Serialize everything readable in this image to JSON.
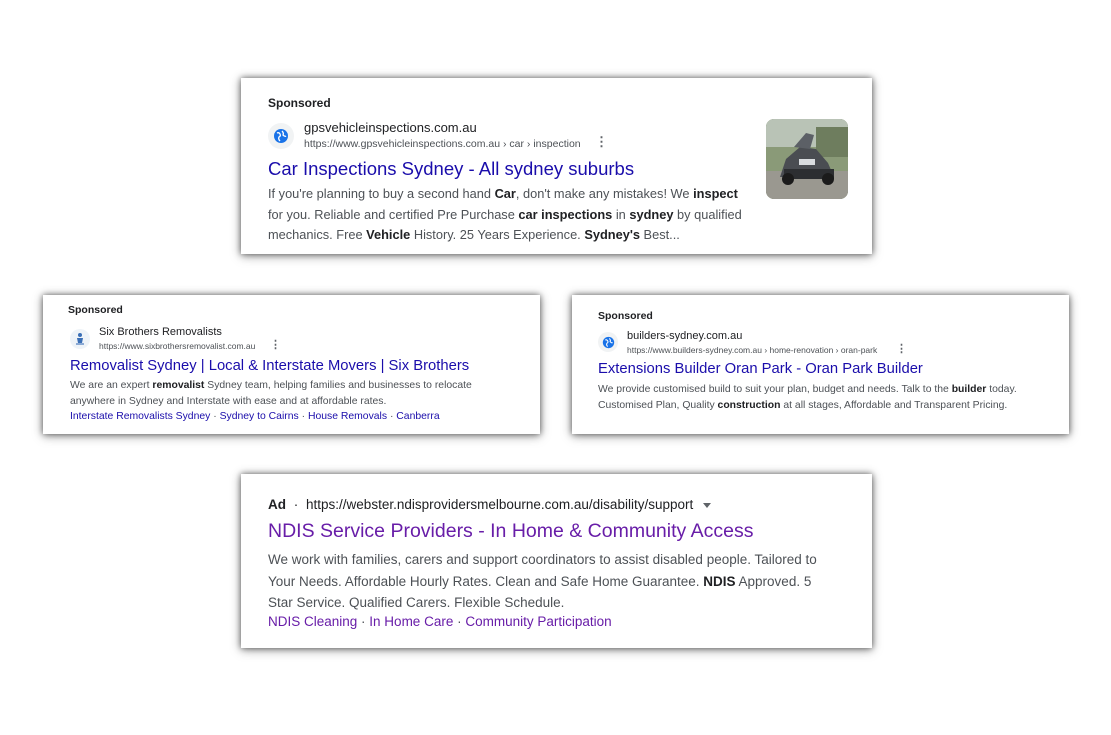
{
  "ad1": {
    "sponsored": "Sponsored",
    "domain": "gpsvehicleinspections.com.au",
    "url": "https://www.gpsvehicleinspections.com.au › car › inspection",
    "title": "Car Inspections Sydney - All sydney suburbs",
    "desc": [
      {
        "t": "If you're planning to buy a second hand "
      },
      {
        "b": "Car"
      },
      {
        "t": ", don't make any mistakes! We "
      },
      {
        "b": "inspect"
      },
      {
        "t": " for you. Reliable and certified Pre Purchase "
      },
      {
        "b": "car inspections"
      },
      {
        "t": " in "
      },
      {
        "b": "sydney"
      },
      {
        "t": " by qualified mechanics. Free "
      },
      {
        "b": "Vehicle"
      },
      {
        "t": " History. 25 Years Experience. "
      },
      {
        "b": "Sydney's"
      },
      {
        "t": " Best..."
      }
    ],
    "icon": "globe-icon",
    "thumbnail": "car-photo"
  },
  "ad2": {
    "sponsored": "Sponsored",
    "domain": "Six Brothers Removalists",
    "url": "https://www.sixbrothersremovalist.com.au",
    "title": "Removalist Sydney | Local & Interstate Movers | Six Brothers",
    "desc": [
      {
        "t": "We are an expert "
      },
      {
        "b": "removalist"
      },
      {
        "t": " Sydney team, helping families and businesses to relocate anywhere in Sydney and Interstate with ease and at affordable rates."
      }
    ],
    "sitelinks": [
      "Interstate Removalists Sydney",
      "Sydney to Cairns",
      "House Removals",
      "Canberra"
    ],
    "icon": "mover-logo-icon"
  },
  "ad3": {
    "sponsored": "Sponsored",
    "domain": "builders-sydney.com.au",
    "url": "https://www.builders-sydney.com.au › home-renovation › oran-park",
    "title": "Extensions Builder Oran Park - Oran Park Builder",
    "desc": [
      {
        "t": "We provide customised build to suit your plan, budget and needs. Talk to the "
      },
      {
        "b": "builder"
      },
      {
        "t": " today. Customised Plan, Quality "
      },
      {
        "b": "construction"
      },
      {
        "t": " at all stages, Affordable and Transparent Pricing."
      }
    ],
    "icon": "globe-icon"
  },
  "ad4": {
    "ad_label": "Ad",
    "sep": "·",
    "url": "https://webster.ndisprovidersmelbourne.com.au/disability/support",
    "title": "NDIS Service Providers - In Home & Community Access",
    "desc": [
      {
        "t": "We work with families, carers and support coordinators to assist disabled people. Tailored to Your Needs. Affordable Hourly Rates. Clean and Safe Home Guarantee. "
      },
      {
        "b": "NDIS"
      },
      {
        "t": " Approved. 5 Star Service. Qualified Carers. Flexible Schedule."
      }
    ],
    "sitelinks": [
      "NDIS Cleaning",
      "In Home Care",
      "Community Participation"
    ],
    "icon": "caret-down-icon"
  },
  "colors": {
    "link": "#1a0dab",
    "visited": "#681da8",
    "text": "#4d5156",
    "dark": "#202124"
  }
}
